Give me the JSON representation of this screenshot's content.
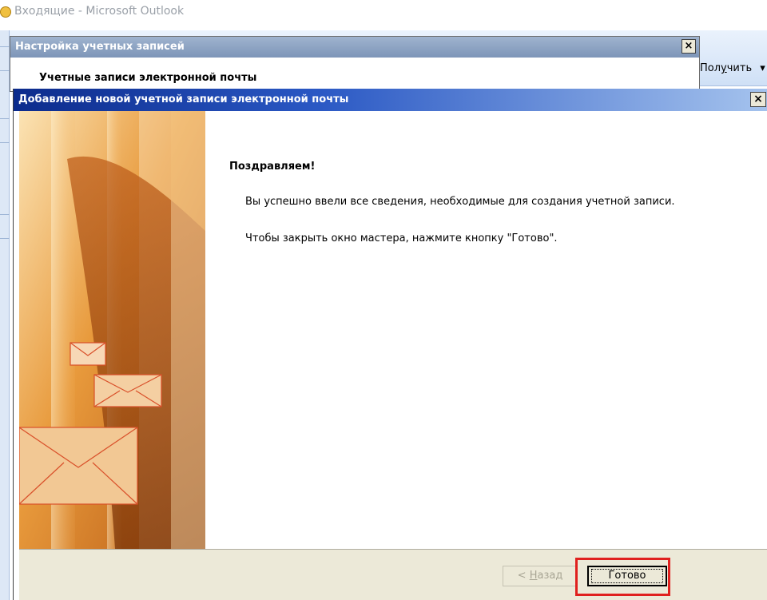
{
  "outlook": {
    "window_title": "Входящие - Microsoft Outlook",
    "receive_prefix": "Пол",
    "receive_underlined": "у",
    "receive_suffix": "чить",
    "receive_arrow": "▾"
  },
  "account_settings": {
    "title": "Настройка учетных записей",
    "subtitle": "Учетные записи электронной почты",
    "close_glyph": "×"
  },
  "wizard": {
    "title": "Добавление новой учетной записи электронной почты",
    "close_glyph": "×",
    "heading": "Поздравляем!",
    "line1": "Вы успешно ввели все сведения, необходимые для создания учетной записи.",
    "line2": "Чтобы закрыть окно мастера, нажмите кнопку \"Готово\".",
    "back_prefix": "< ",
    "back_underlined": "Н",
    "back_suffix": "азад",
    "finish_label": "Готово"
  },
  "colors": {
    "wizard_title_start": "#0c2b8c",
    "wizard_title_end": "#a6c4ee",
    "highlight": "#e0201e",
    "dialog_face": "#ece9d8"
  }
}
